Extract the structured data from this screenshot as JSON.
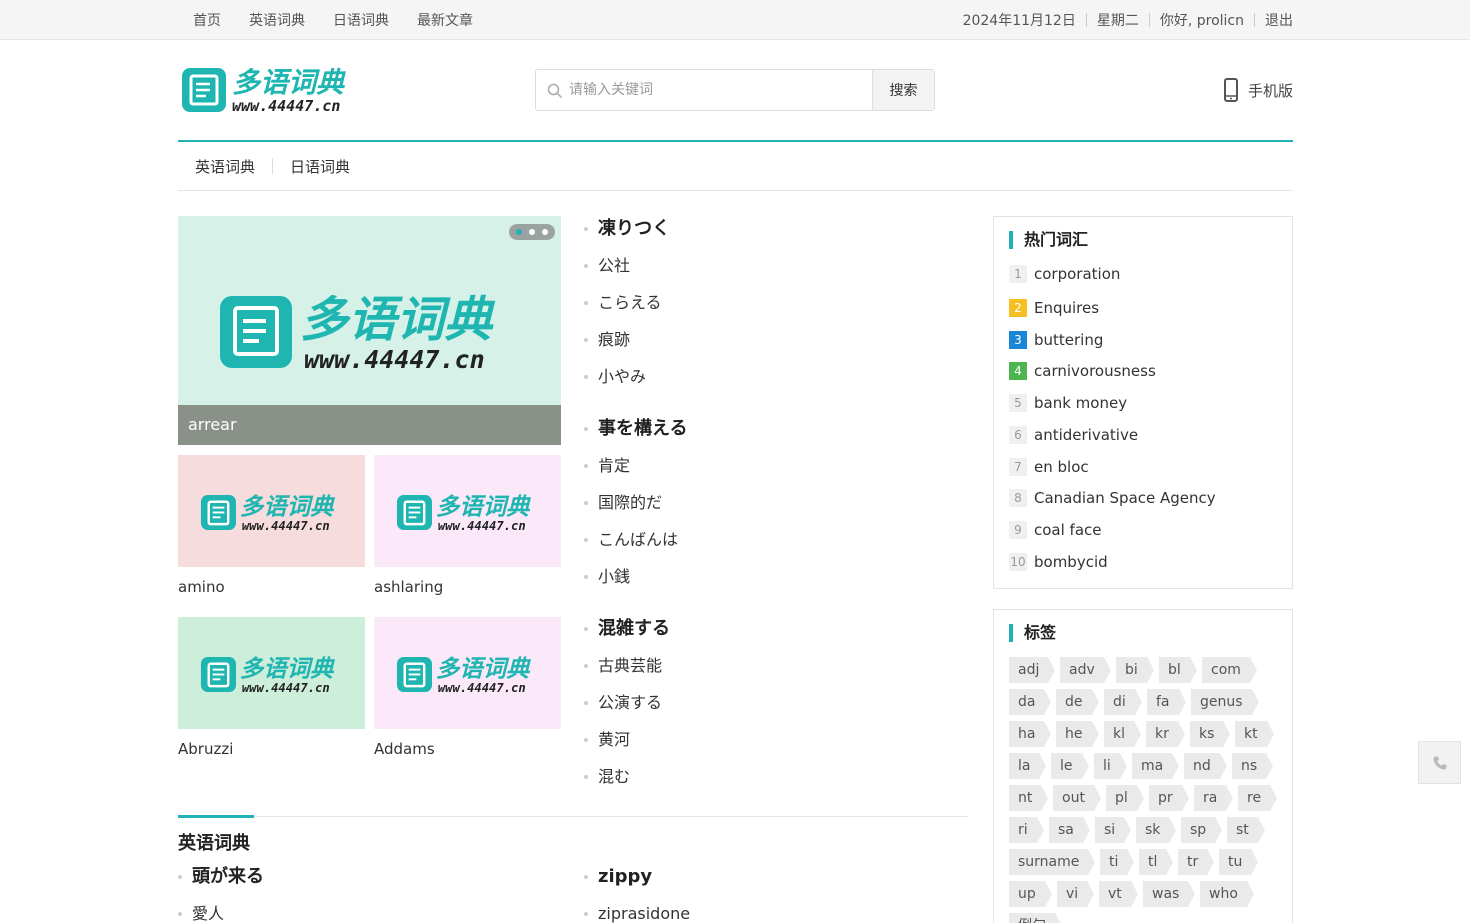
{
  "topbar": {
    "nav": [
      "首页",
      "英语词典",
      "日语词典",
      "最新文章"
    ],
    "date": "2024年11月12日",
    "weekday": "星期二",
    "greeting": "你好, prolicn",
    "logout": "退出"
  },
  "logo": {
    "cn": "多语词典",
    "url": "www.44447.cn"
  },
  "search": {
    "placeholder": "请输入关键词",
    "button": "搜索"
  },
  "mobile_label": "手机版",
  "subnav": [
    "英语词典",
    "日语词典"
  ],
  "slider": {
    "caption": "arrear",
    "dots": 3,
    "active_dot": 1
  },
  "thumbs": [
    {
      "label": "amino",
      "bg": "#f6dcdd"
    },
    {
      "label": "ashlaring",
      "bg": "#fbe9fa"
    },
    {
      "label": "Abruzzi",
      "bg": "#cdeedb"
    },
    {
      "label": "Addams",
      "bg": "#fbe9fa"
    }
  ],
  "word_groups": [
    {
      "head": "凍りつく",
      "items": [
        "公社",
        "こらえる",
        "痕跡",
        "小やみ"
      ]
    },
    {
      "head": "事を構える",
      "items": [
        "肯定",
        "国際的だ",
        "こんばんは",
        "小銭"
      ]
    },
    {
      "head": "混雑する",
      "items": [
        "古典芸能",
        "公演する",
        "黄河",
        "混む"
      ]
    }
  ],
  "section": {
    "title": "英语词典",
    "left": {
      "head": "頭が来る",
      "items": [
        "愛人"
      ]
    },
    "right": {
      "head": "zippy",
      "items": [
        "ziprasidone"
      ]
    }
  },
  "hot": {
    "title": "热门词汇",
    "items": [
      {
        "rank": "1",
        "word": "corporation"
      },
      {
        "rank": "2",
        "word": "Enquires"
      },
      {
        "rank": "3",
        "word": "buttering"
      },
      {
        "rank": "4",
        "word": "carnivorousness"
      },
      {
        "rank": "5",
        "word": "bank money"
      },
      {
        "rank": "6",
        "word": "antiderivative"
      },
      {
        "rank": "7",
        "word": "en bloc"
      },
      {
        "rank": "8",
        "word": "Canadian Space Agency"
      },
      {
        "rank": "9",
        "word": "coal face"
      },
      {
        "rank": "10",
        "word": "bombycid"
      }
    ]
  },
  "tags": {
    "title": "标签",
    "rows": [
      [
        "adj",
        "adv",
        "bi",
        "bl",
        "com"
      ],
      [
        "da",
        "de",
        "di",
        "fa",
        "genus"
      ],
      [
        "ha",
        "he",
        "kl",
        "kr",
        "ks",
        "kt"
      ],
      [
        "la",
        "le",
        "li",
        "ma",
        "nd",
        "ns"
      ],
      [
        "nt",
        "out",
        "pl",
        "pr",
        "ra",
        "re"
      ],
      [
        "ri",
        "sa",
        "si",
        "sk",
        "sp",
        "st"
      ],
      [
        "surname",
        "ti",
        "tl",
        "tr",
        "tu"
      ],
      [
        "up",
        "vi",
        "vt",
        "was",
        "who"
      ],
      [
        "例句"
      ]
    ]
  },
  "colors": {
    "accent": "#20b2b8",
    "logo_teal": "#1fb5b0"
  }
}
